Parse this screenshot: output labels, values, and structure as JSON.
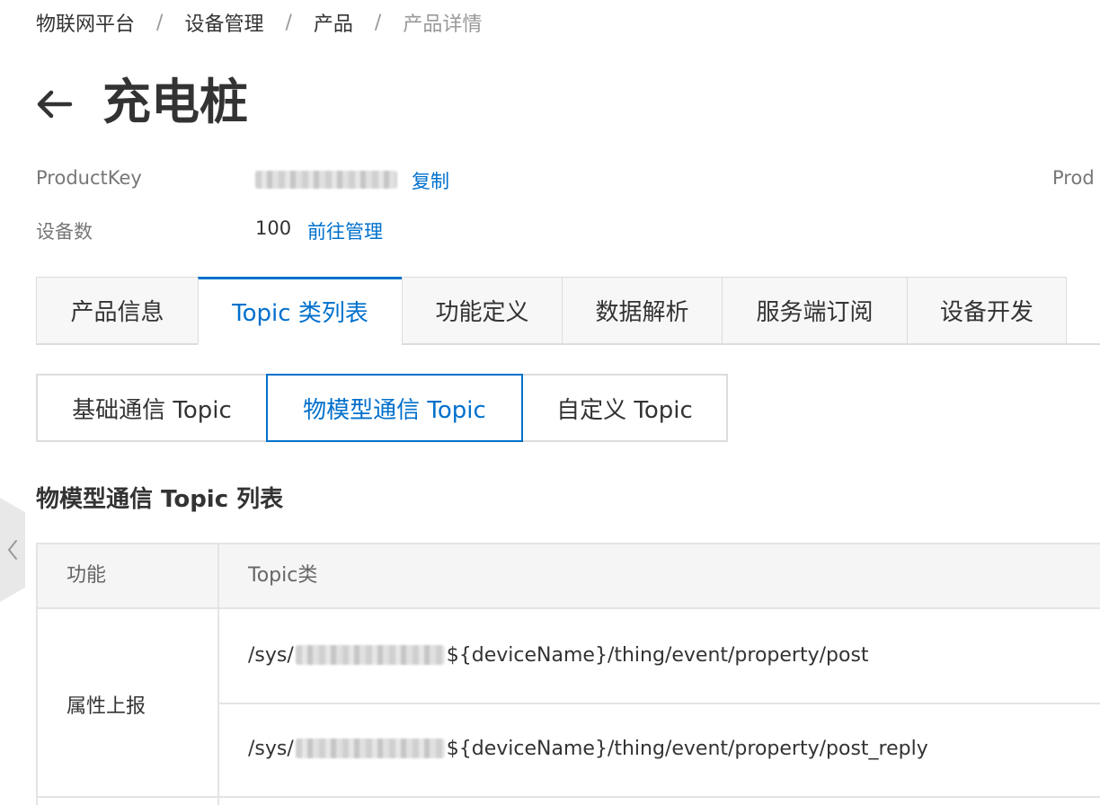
{
  "breadcrumb": {
    "items": [
      "物联网平台",
      "设备管理",
      "产品",
      "产品详情"
    ],
    "separator": "/"
  },
  "header": {
    "title": "充电桩",
    "back_icon": "arrow-left-icon"
  },
  "info": {
    "product_key_label": "ProductKey",
    "copy_link": "复制",
    "right_label_partial": "Prod",
    "device_count_label": "设备数",
    "device_count_value": "100",
    "manage_link": "前往管理"
  },
  "tabs": [
    {
      "label": "产品信息",
      "active": false
    },
    {
      "label": "Topic 类列表",
      "active": true
    },
    {
      "label": "功能定义",
      "active": false
    },
    {
      "label": "数据解析",
      "active": false
    },
    {
      "label": "服务端订阅",
      "active": false
    },
    {
      "label": "设备开发",
      "active": false
    }
  ],
  "subtabs": [
    {
      "label": "基础通信 Topic",
      "active": false
    },
    {
      "label": "物模型通信 Topic",
      "active": true
    },
    {
      "label": "自定义 Topic",
      "active": false
    }
  ],
  "section": {
    "title": "物模型通信 Topic 列表"
  },
  "table": {
    "columns": [
      "功能",
      "Topic类"
    ],
    "rows": [
      {
        "function": "属性上报",
        "topics": [
          {
            "prefix": "/sys/",
            "suffix": "${deviceName}/thing/event/property/post"
          },
          {
            "prefix": "/sys/",
            "suffix": "${deviceName}/thing/event/property/post_reply"
          }
        ]
      }
    ]
  },
  "colors": {
    "accent": "#0070cc",
    "text": "#333333",
    "muted": "#999999",
    "border": "#dcdcdc"
  },
  "icons": {
    "back": "arrow-left-icon",
    "collapse": "chevron-left-icon"
  }
}
